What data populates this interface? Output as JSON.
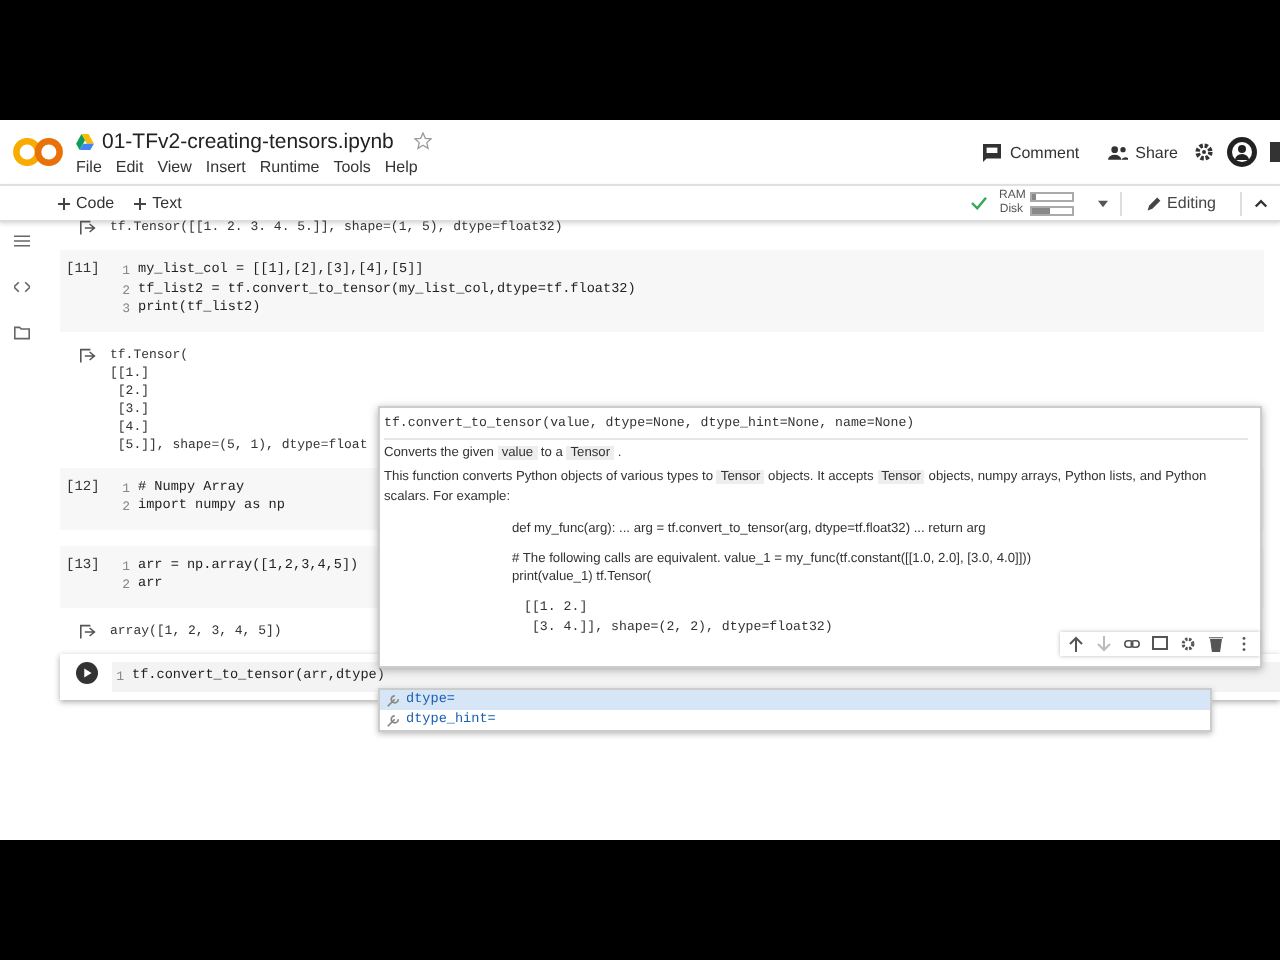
{
  "header": {
    "title": "01-TFv2-creating-tensors.ipynb",
    "starred": false,
    "menu": [
      "File",
      "Edit",
      "View",
      "Insert",
      "Runtime",
      "Tools",
      "Help"
    ],
    "actions": [
      "Comment",
      "Share"
    ]
  },
  "toolbar": {
    "add": [
      "Code",
      "Text"
    ],
    "resources": [
      {
        "label": "RAM",
        "level": 0.12
      },
      {
        "label": "Disk",
        "level": 0.45
      }
    ],
    "mode": "Editing"
  },
  "cells": [
    {
      "kind": "output",
      "lines": [
        "tf.Tensor([[1. 2. 3. 4. 5.]], shape=(1, 5), dtype=float32)"
      ]
    },
    {
      "kind": "code",
      "count": "[11]",
      "active": false,
      "lines": [
        {
          "no": "1",
          "code": "my_list_col = [[1],[2],[3],[4],[5]]"
        },
        {
          "no": "2",
          "code": "tf_list2 = tf.convert_to_tensor(my_list_col,dtype=tf.float32)"
        },
        {
          "no": "3",
          "code": "print(tf_list2)"
        }
      ]
    },
    {
      "kind": "output",
      "lines": [
        "tf.Tensor(",
        "[[1.]",
        " [2.]",
        " [3.]",
        " [4.]",
        " [5.]], shape=(5, 1), dtype=float"
      ]
    },
    {
      "kind": "code",
      "count": "[12]",
      "active": false,
      "lines": [
        {
          "no": "1",
          "code": "# Numpy Array"
        },
        {
          "no": "2",
          "code": "import numpy as np"
        }
      ]
    },
    {
      "kind": "code",
      "count": "[13]",
      "active": false,
      "lines": [
        {
          "no": "1",
          "code": "arr = np.array([1,2,3,4,5])"
        },
        {
          "no": "2",
          "code": "arr"
        }
      ]
    },
    {
      "kind": "output",
      "lines": [
        "array([1, 2, 3, 4, 5])"
      ]
    },
    {
      "kind": "code",
      "active": true,
      "lines": [
        {
          "no": "1",
          "code": "tf.convert_to_tensor(arr,dtype)"
        }
      ]
    }
  ],
  "tooltip": {
    "signature": "tf.convert_to_tensor(value, dtype=None, dtype_hint=None, name=None)",
    "paragraphs": [
      [
        {
          "text": "Converts the given "
        },
        {
          "text": "value",
          "code": true
        },
        {
          "text": " to a "
        },
        {
          "text": "Tensor",
          "code": true
        },
        {
          "text": " ."
        }
      ],
      [
        {
          "text": "This function converts Python objects of various types to "
        },
        {
          "text": "Tensor",
          "code": true
        },
        {
          "text": " objects. It accepts "
        },
        {
          "text": "Tensor",
          "code": true
        },
        {
          "text": " objects, numpy arrays, Python lists, and Python scalars. For example:"
        }
      ]
    ],
    "example": [
      "def my_func(arg): ... arg = tf.convert_to_tensor(arg, dtype=tf.float32) ... return arg",
      "# The following calls are equivalent. value_1 = my_func(tf.constant([[1.0, 2.0], [3.0, 4.0]]))\nprint(value_1) tf.Tensor("
    ],
    "code": [
      "[[1. 2.]",
      " [3. 4.]], shape=(2, 2), dtype=float32)"
    ]
  },
  "completions": [
    {
      "label": "dtype=",
      "selected": true
    },
    {
      "label": "dtype_hint=",
      "selected": false
    }
  ]
}
